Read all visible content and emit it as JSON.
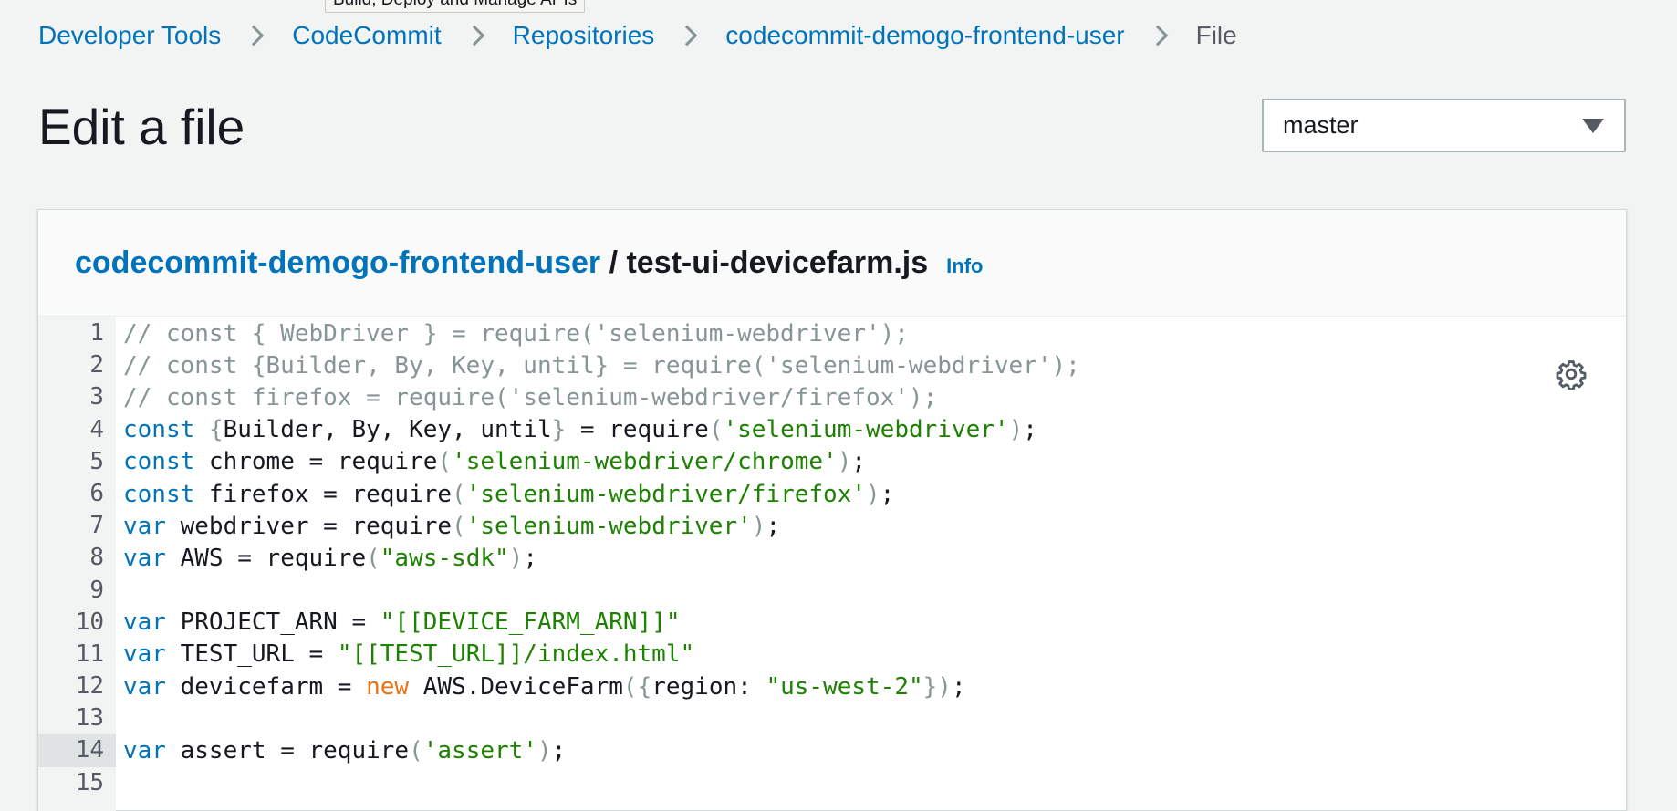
{
  "tooltip": "Build, Deploy and Manage APIs",
  "breadcrumb": {
    "items": [
      "Developer Tools",
      "CodeCommit",
      "Repositories",
      "codecommit-demogo-frontend-user"
    ],
    "current": "File"
  },
  "page": {
    "title": "Edit a file"
  },
  "branch": {
    "selected": "master"
  },
  "panel": {
    "repo": "codecommit-demogo-frontend-user",
    "separator": " / ",
    "file": "test-ui-devicefarm.js",
    "info": "Info"
  },
  "editor": {
    "active_line": 14,
    "lines": [
      {
        "n": "1",
        "t": "// const { WebDriver } = require('selenium-webdriver');"
      },
      {
        "n": "2",
        "t": "// const {Builder, By, Key, until} = require('selenium-webdriver');"
      },
      {
        "n": "3",
        "t": "// const firefox = require('selenium-webdriver/firefox');"
      },
      {
        "n": "4",
        "t": "const {Builder, By, Key, until} = require('selenium-webdriver');"
      },
      {
        "n": "5",
        "t": "const chrome = require('selenium-webdriver/chrome');"
      },
      {
        "n": "6",
        "t": "const firefox = require('selenium-webdriver/firefox');"
      },
      {
        "n": "7",
        "t": "var webdriver = require('selenium-webdriver');"
      },
      {
        "n": "8",
        "t": "var AWS = require(\"aws-sdk\");"
      },
      {
        "n": "9",
        "t": ""
      },
      {
        "n": "10",
        "t": "var PROJECT_ARN = \"[[DEVICE_FARM_ARN]]\""
      },
      {
        "n": "11",
        "t": "var TEST_URL = \"[[TEST_URL]]/index.html\""
      },
      {
        "n": "12",
        "t": "var devicefarm = new AWS.DeviceFarm({region: \"us-west-2\"});"
      },
      {
        "n": "13",
        "t": ""
      },
      {
        "n": "14",
        "t": "var assert = require('assert');"
      },
      {
        "n": "15",
        "t": ""
      }
    ]
  },
  "colors": {
    "link": "#0073bb",
    "keyword": "#0073bb",
    "string": "#1d8102",
    "comment": "#879596",
    "new_keyword": "#ec7211"
  },
  "icons": {
    "settings": "gear-icon",
    "dropdown": "caret-down-icon",
    "breadcrumb_separator": "chevron-right-icon"
  }
}
